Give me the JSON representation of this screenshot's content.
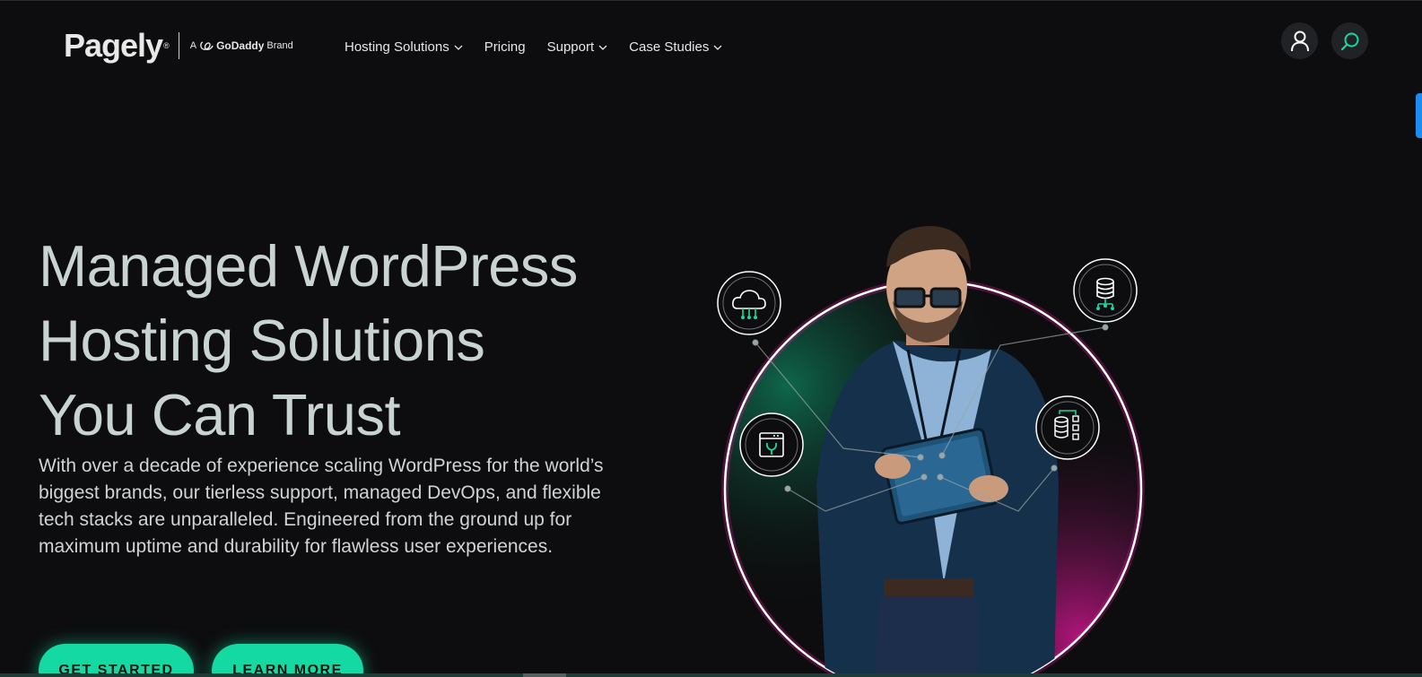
{
  "header": {
    "logo": {
      "name": "Pagely",
      "registered": "®",
      "brand_prefix": "A",
      "brand_name": "GoDaddy",
      "brand_suffix": "Brand"
    },
    "nav": [
      {
        "label": "Hosting Solutions",
        "has_dropdown": true
      },
      {
        "label": "Pricing",
        "has_dropdown": false
      },
      {
        "label": "Support",
        "has_dropdown": true
      },
      {
        "label": "Case Studies",
        "has_dropdown": true
      }
    ],
    "account_icon": "user-icon",
    "search_icon": "search-icon"
  },
  "hero": {
    "title_lines": [
      "Managed WordPress",
      "Hosting Solutions",
      "You Can Trust"
    ],
    "description": "With over a decade of experience scaling WordPress for the world’s biggest brands, our tierless support, managed DevOps, and flexible tech stacks are unparalleled. Engineered from the ground up for maximum uptime and durability for flawless user experiences.",
    "buttons": {
      "get_started": "GET STARTED",
      "learn_more": "LEARN MORE"
    },
    "illustration": {
      "icons": [
        "cloud-network-icon",
        "database-icon",
        "web-tools-icon",
        "database-diagram-icon"
      ],
      "subject": "man-with-tablet"
    }
  },
  "colors": {
    "background": "#0d0d0f",
    "accent": "#14d9a2",
    "title": "#c9d4d2",
    "glow_pink": "#b5157e",
    "glow_green": "#0f6b4f",
    "side_tab": "#1b8cf2"
  }
}
